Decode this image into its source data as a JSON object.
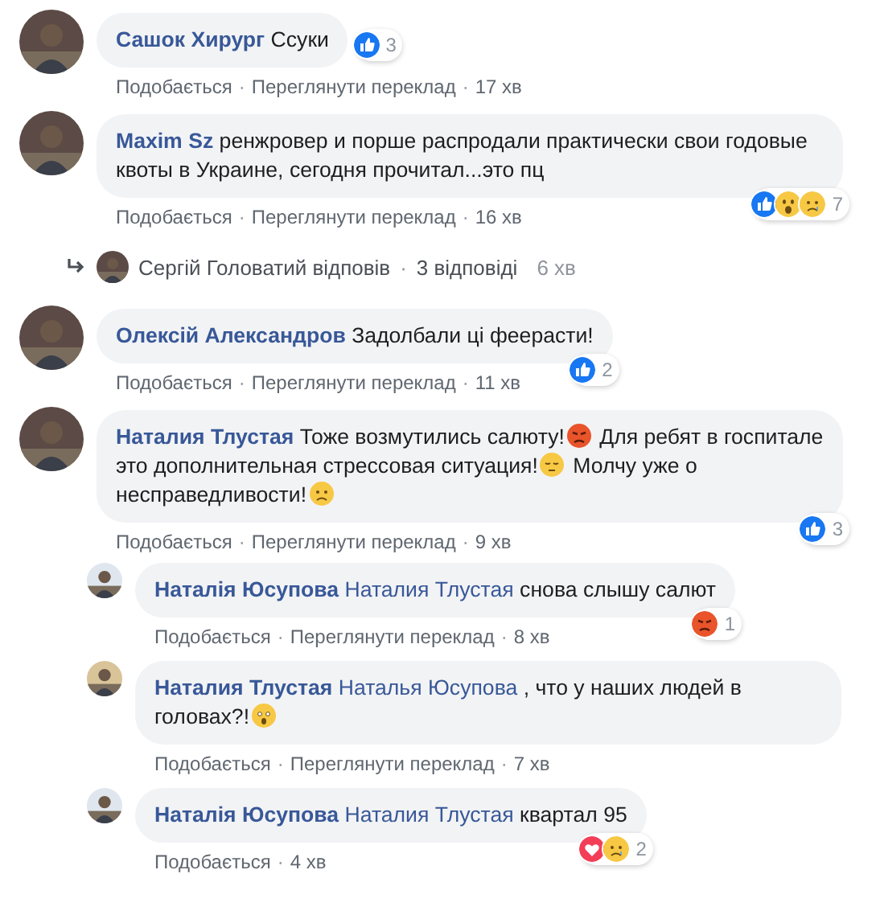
{
  "comments": [
    {
      "avatar": {
        "kind": "picture"
      },
      "segments": [
        {
          "kind": "author",
          "text": "Сашок Хирург"
        },
        {
          "kind": "text",
          "text": " Ссуки"
        }
      ],
      "reactions": {
        "items": [
          {
            "kind": "like"
          }
        ],
        "count": "3"
      },
      "meta": [
        "Подобається",
        "·",
        "Переглянути переклад",
        "·",
        "17 хв"
      ]
    },
    {
      "avatar": {
        "kind": "picture"
      },
      "segments": [
        {
          "kind": "author",
          "text": "Maxim Sz"
        },
        {
          "kind": "text",
          "text": " ренжровер и порше распродали практически свои годовые квоты в Украине, сегодня прочитал...это пц"
        }
      ],
      "reactions": {
        "items": [
          {
            "kind": "like"
          },
          {
            "kind": "wow"
          },
          {
            "kind": "sad"
          }
        ],
        "count": "7"
      },
      "meta": [
        "Подобається",
        "·",
        "Переглянути переклад",
        "·",
        "16 хв"
      ],
      "replies_link": {
        "name": "Сергій Головатий відповів",
        "separator": "·",
        "count": "3 відповіді",
        "time": "6 хв"
      }
    },
    {
      "avatar": {
        "kind": "picture"
      },
      "segments": [
        {
          "kind": "author",
          "text": "Олексій Александров"
        },
        {
          "kind": "text",
          "text": " Задолбали ці феерасти!"
        }
      ],
      "reactions": {
        "items": [
          {
            "kind": "like"
          }
        ],
        "count": "2"
      },
      "meta": [
        "Подобається",
        "·",
        "Переглянути переклад",
        "·",
        "11 хв"
      ]
    },
    {
      "avatar": {
        "kind": "picture"
      },
      "segments": [
        {
          "kind": "author",
          "text": "Наталия Тлустая"
        },
        {
          "kind": "text",
          "text": " Тоже возмутились салюту!"
        },
        {
          "kind": "angry"
        },
        {
          "kind": "text",
          "text": " Для ребят в госпитале это дополнительная стрессовая ситуация!"
        },
        {
          "kind": "pensive"
        },
        {
          "kind": "text",
          "text": " Молчу уже о несправедливости!"
        },
        {
          "kind": "frown"
        }
      ],
      "reactions": {
        "items": [
          {
            "kind": "like"
          }
        ],
        "count": "3"
      },
      "meta": [
        "Подобається",
        "·",
        "Переглянути переклад",
        "·",
        "9 хв"
      ],
      "children": [
        {
          "avatar": {
            "kind": "picture"
          },
          "segments": [
            {
              "kind": "author",
              "text": "Наталія Юсупова"
            },
            {
              "kind": "mention",
              "text": " Наталия Тлустая"
            },
            {
              "kind": "text",
              "text": " снова слышу салют"
            }
          ],
          "reactions": {
            "items": [
              {
                "kind": "angry"
              }
            ],
            "count": "1"
          },
          "meta": [
            "Подобається",
            "·",
            "Переглянути переклад",
            "·",
            "8 хв"
          ]
        },
        {
          "avatar": {
            "kind": "picture"
          },
          "segments": [
            {
              "kind": "author",
              "text": "Наталия Тлустая"
            },
            {
              "kind": "mention",
              "text": " Наталья Юсупова"
            },
            {
              "kind": "text",
              "text": " , что у наших людей в головах?!"
            },
            {
              "kind": "shocked"
            }
          ],
          "meta": [
            "Подобається",
            "·",
            "Переглянути переклад",
            "·",
            "7 хв"
          ]
        },
        {
          "avatar": {
            "kind": "picture"
          },
          "segments": [
            {
              "kind": "author",
              "text": "Наталія Юсупова"
            },
            {
              "kind": "mention",
              "text": " Наталия Тлустая"
            },
            {
              "kind": "text",
              "text": " квартал 95"
            }
          ],
          "reactions": {
            "items": [
              {
                "kind": "love"
              },
              {
                "kind": "sad"
              }
            ],
            "count": "2"
          },
          "meta": [
            "Подобається",
            "·",
            "4 хв"
          ]
        }
      ]
    }
  ]
}
